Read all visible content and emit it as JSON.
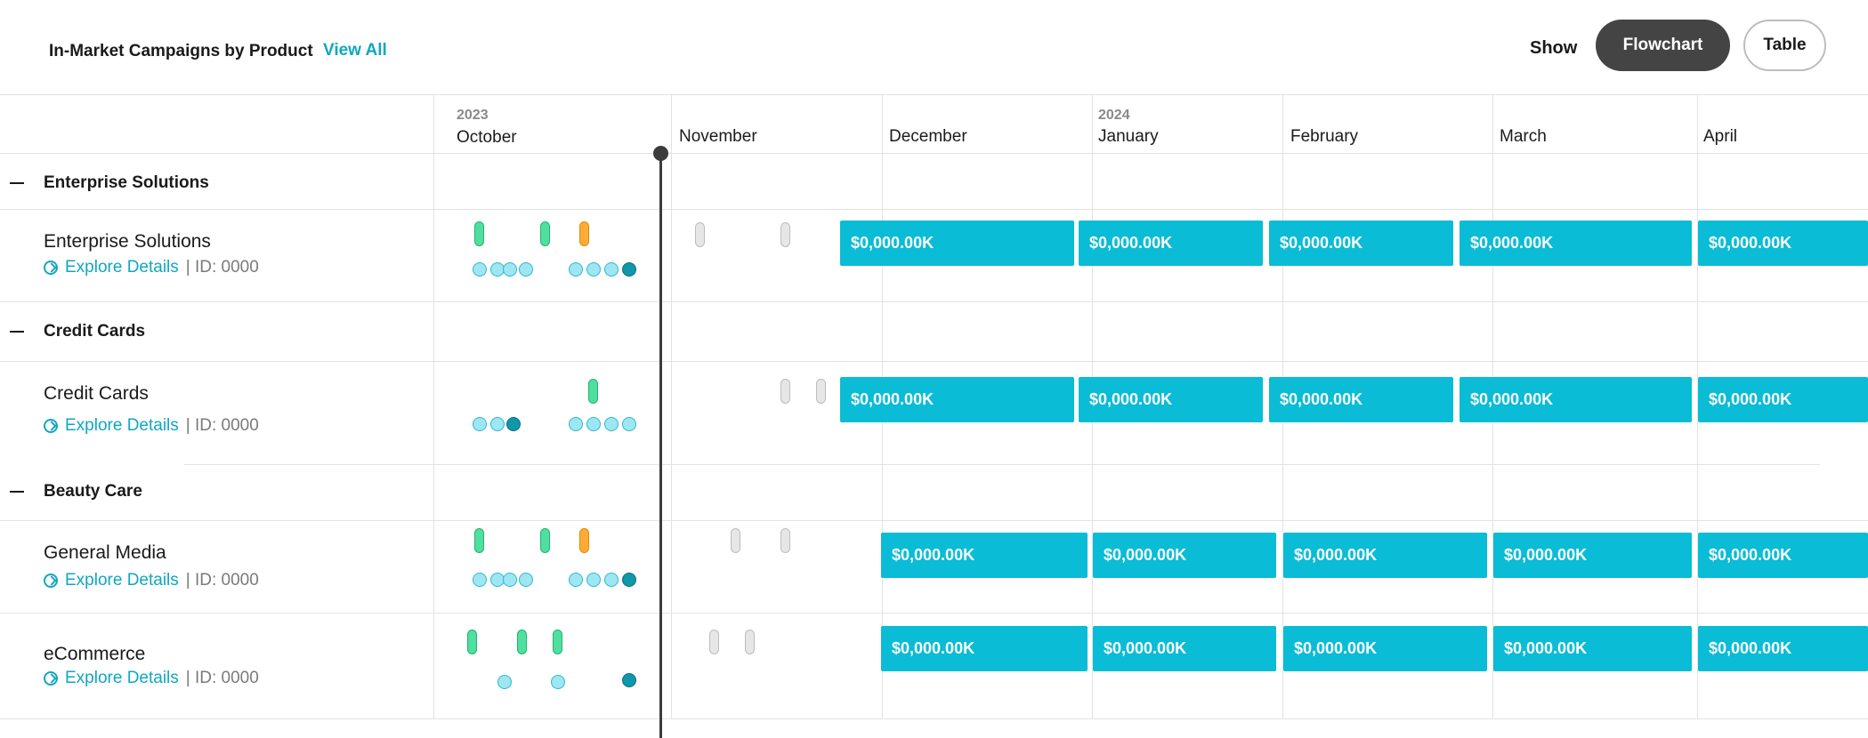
{
  "header": {
    "title": "In-Market Campaigns by Product",
    "view_all": "View All",
    "show_label": "Show",
    "toggle_flowchart": "Flowchart",
    "toggle_table": "Table",
    "active_toggle": "Flowchart"
  },
  "timeline": {
    "months": [
      "October",
      "November",
      "December",
      "January",
      "February",
      "March",
      "April"
    ],
    "years": [
      {
        "label": "2023",
        "month": "October"
      },
      {
        "label": "2024",
        "month": "January"
      }
    ]
  },
  "colors": {
    "accent": "#10a7c0",
    "bar": "#0abcd5",
    "marker_green": "#4fe0a0",
    "marker_orange": "#ffab36",
    "marker_grey": "#e6e6e6",
    "dot_light": "#9ee6f2",
    "dot_dark": "#0f97aa",
    "toggle_active": "#444444"
  },
  "icons": [
    "collapse-dash-icon",
    "compass-icon"
  ],
  "groups": [
    {
      "label": "Enterprise Solutions",
      "rows": [
        {
          "name": "Enterprise Solutions",
          "link": "Explore Details",
          "id": "| ID: 0000",
          "bars": [
            "$0,000.00K",
            "$0,000.00K",
            "$0,000.00K",
            "$0,000.00K",
            "$0,000.00K"
          ]
        }
      ]
    },
    {
      "label": "Credit Cards",
      "rows": [
        {
          "name": "Credit Cards",
          "link": "Explore Details",
          "id": "| ID: 0000",
          "bars": [
            "$0,000.00K",
            "$0,000.00K",
            "$0,000.00K",
            "$0,000.00K",
            "$0,000.00K"
          ]
        }
      ]
    },
    {
      "label": "Beauty Care",
      "rows": [
        {
          "name": "General Media",
          "link": "Explore Details",
          "id": "| ID: 0000",
          "bars": [
            "$0,000.00K",
            "$0,000.00K",
            "$0,000.00K",
            "$0,000.00K",
            "$0,000.00K"
          ]
        },
        {
          "name": "eCommerce",
          "link": "Explore Details",
          "id": "| ID: 0000",
          "bars": [
            "$0,000.00K",
            "$0,000.00K",
            "$0,000.00K",
            "$0,000.00K",
            "$0,000.00K"
          ]
        }
      ]
    }
  ]
}
